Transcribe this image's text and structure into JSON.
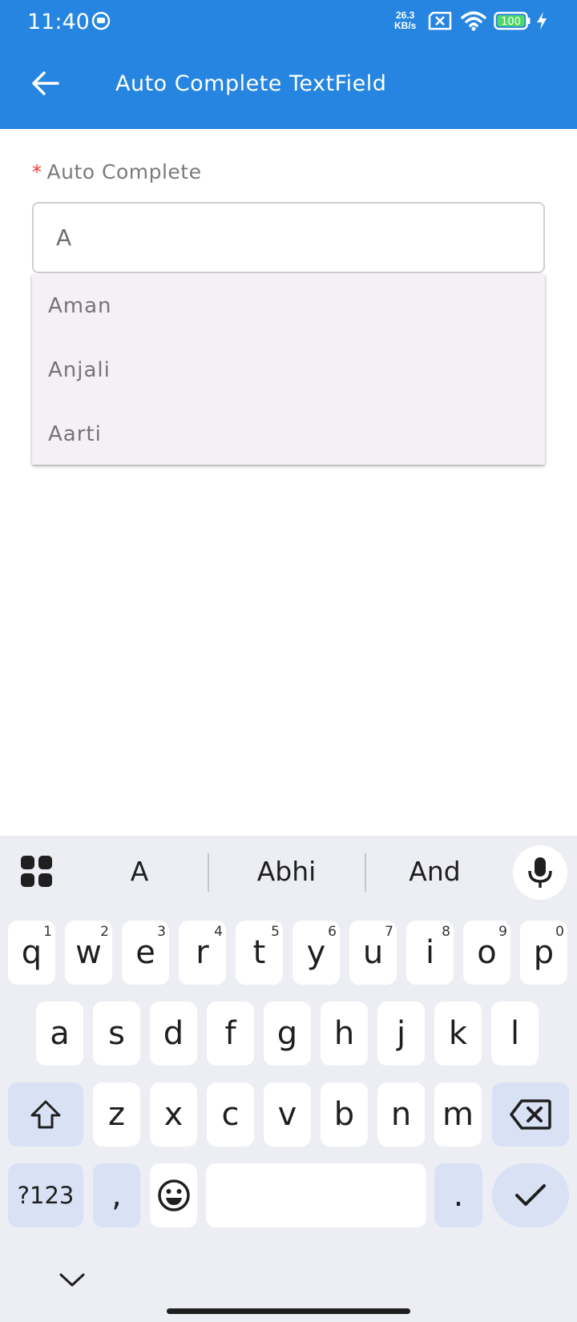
{
  "status_bar": {
    "time": "11:40",
    "net_speed_value": "26.3",
    "net_speed_unit": "KB/s",
    "battery_level": "100"
  },
  "app_bar": {
    "title": "Auto Complete TextField",
    "color": "#2585e0"
  },
  "form": {
    "required_marker": "*",
    "label": "Auto Complete",
    "input_value": "A",
    "suggestions": [
      "Aman",
      "Anjali",
      "Aarti"
    ]
  },
  "keyboard": {
    "suggestions": [
      "A",
      "Abhi",
      "And"
    ],
    "row1": [
      {
        "key": "q",
        "num": "1"
      },
      {
        "key": "w",
        "num": "2"
      },
      {
        "key": "e",
        "num": "3"
      },
      {
        "key": "r",
        "num": "4"
      },
      {
        "key": "t",
        "num": "5"
      },
      {
        "key": "y",
        "num": "6"
      },
      {
        "key": "u",
        "num": "7"
      },
      {
        "key": "i",
        "num": "8"
      },
      {
        "key": "o",
        "num": "9"
      },
      {
        "key": "p",
        "num": "0"
      }
    ],
    "row2": [
      "a",
      "s",
      "d",
      "f",
      "g",
      "h",
      "j",
      "k",
      "l"
    ],
    "row3": [
      "z",
      "x",
      "c",
      "v",
      "b",
      "n",
      "m"
    ],
    "symbols_label": "?123",
    "comma_label": ",",
    "period_label": "."
  }
}
